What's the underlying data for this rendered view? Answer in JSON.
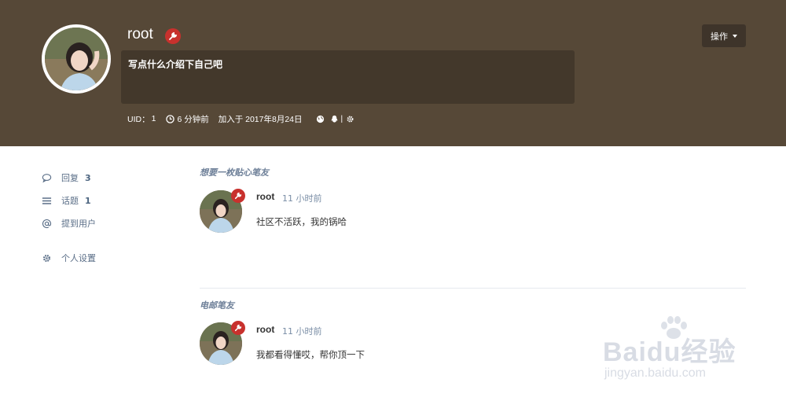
{
  "profile": {
    "username": "root",
    "bio": "写点什么介绍下自己吧",
    "uid_label": "UID：",
    "uid": "1",
    "last_seen": "6 分钟前",
    "joined": "加入于 2017年8月24日",
    "actions_label": "操作",
    "colors": {
      "hero_bg": "#564837",
      "bio_bg": "#43382b",
      "badge": "#c8312d"
    }
  },
  "sidebar": {
    "items": [
      {
        "label": "回复",
        "count": "3",
        "icon": "comment-icon"
      },
      {
        "label": "话题",
        "count": "1",
        "icon": "list-icon"
      },
      {
        "label": "提到用户",
        "count": "",
        "icon": "at-icon"
      },
      {
        "label": "个人设置",
        "count": "",
        "icon": "gear-icon"
      }
    ]
  },
  "posts": [
    {
      "discussion": "想要一枚贴心笔友",
      "author": "root",
      "time": "11 小时前",
      "content": "社区不活跃，我的锅哈"
    },
    {
      "discussion": "电邮笔友",
      "author": "root",
      "time": "11 小时前",
      "content": "我都看得懂哎，帮你顶一下"
    }
  ],
  "watermark": {
    "logo": "Baidu经验",
    "url": "jingyan.baidu.com"
  }
}
